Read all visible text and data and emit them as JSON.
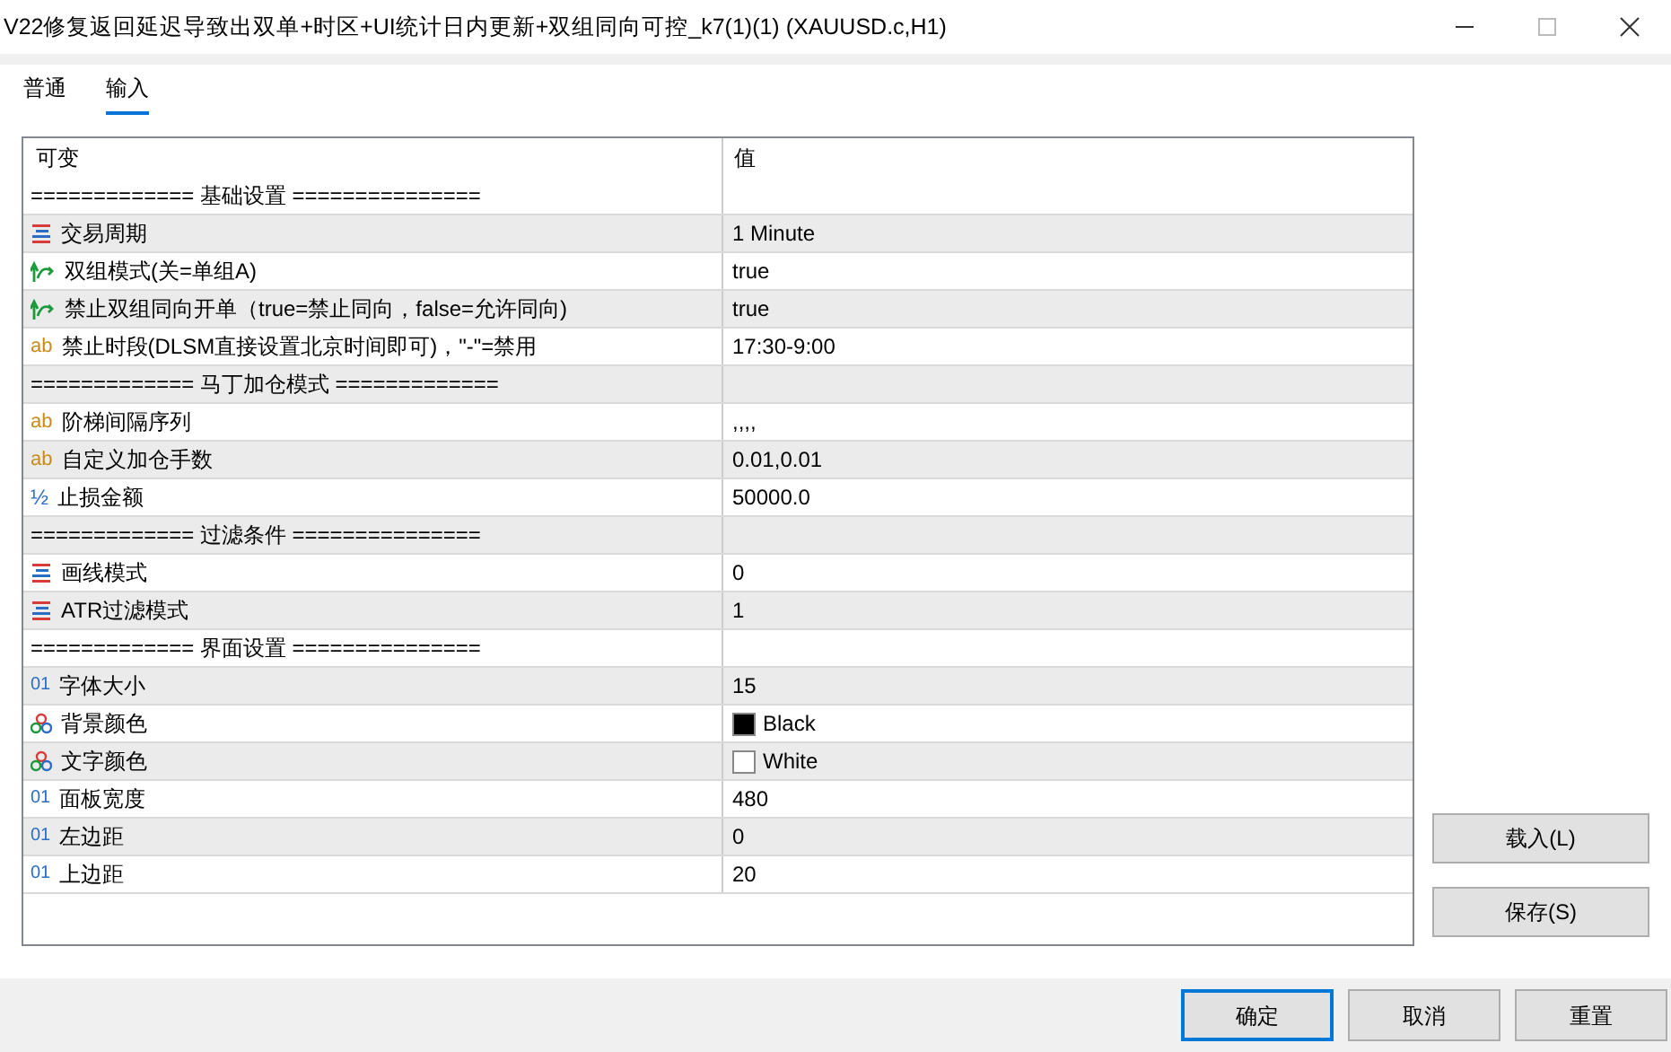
{
  "window": {
    "title": "V22修复返回延迟导致出双单+时区+UI统计日内更新+双组同向可控_k7(1)(1) (XAUUSD.c,H1)"
  },
  "tabs": [
    {
      "label": "普通",
      "selected": false
    },
    {
      "label": "输入",
      "selected": true
    }
  ],
  "table": {
    "columns": [
      "可变",
      "值"
    ],
    "rows": [
      {
        "kind": "section",
        "name": "============= 基础设置 ===============",
        "value": ""
      },
      {
        "kind": "enum",
        "name": "交易周期",
        "value": "1 Minute"
      },
      {
        "kind": "bool",
        "name": "双组模式(关=单组A)",
        "value": "true"
      },
      {
        "kind": "bool",
        "name": "禁止双组同向开单（true=禁止同向，false=允许同向)",
        "value": "true"
      },
      {
        "kind": "string",
        "icon": "ab",
        "name": "禁止时段(DLSM直接设置北京时间即可)，\"-\"=禁用",
        "value": "17:30-9:00"
      },
      {
        "kind": "section",
        "name": "============= 马丁加仓模式 =============",
        "value": ""
      },
      {
        "kind": "string",
        "icon": "ab",
        "name": "阶梯间隔序列",
        "value": ",,,,"
      },
      {
        "kind": "string",
        "icon": "ab",
        "name": "自定义加仓手数",
        "value": "0.01,0.01"
      },
      {
        "kind": "double",
        "icon": "½",
        "name": "止损金额",
        "value": "50000.0"
      },
      {
        "kind": "section",
        "name": "============= 过滤条件 ===============",
        "value": ""
      },
      {
        "kind": "enum",
        "name": "画线模式",
        "value": "0"
      },
      {
        "kind": "enum",
        "name": "ATR过滤模式",
        "value": "1"
      },
      {
        "kind": "section",
        "name": "============= 界面设置 ===============",
        "value": ""
      },
      {
        "kind": "int",
        "icon": "01",
        "name": "字体大小",
        "value": "15"
      },
      {
        "kind": "color",
        "name": "背景颜色",
        "value": "Black",
        "color": "#000000"
      },
      {
        "kind": "color",
        "name": "文字颜色",
        "value": "White",
        "color": "#ffffff"
      },
      {
        "kind": "int",
        "icon": "01",
        "name": "面板宽度",
        "value": "480"
      },
      {
        "kind": "int",
        "icon": "01",
        "name": "左边距",
        "value": "0"
      },
      {
        "kind": "int",
        "icon": "01",
        "name": "上边距",
        "value": "20"
      }
    ]
  },
  "side_buttons": [
    "载入(L)",
    "保存(S)"
  ],
  "buttons": [
    {
      "label": "确定",
      "selected": true
    },
    {
      "label": "取消",
      "selected": false
    },
    {
      "label": "重置",
      "selected": false
    }
  ]
}
